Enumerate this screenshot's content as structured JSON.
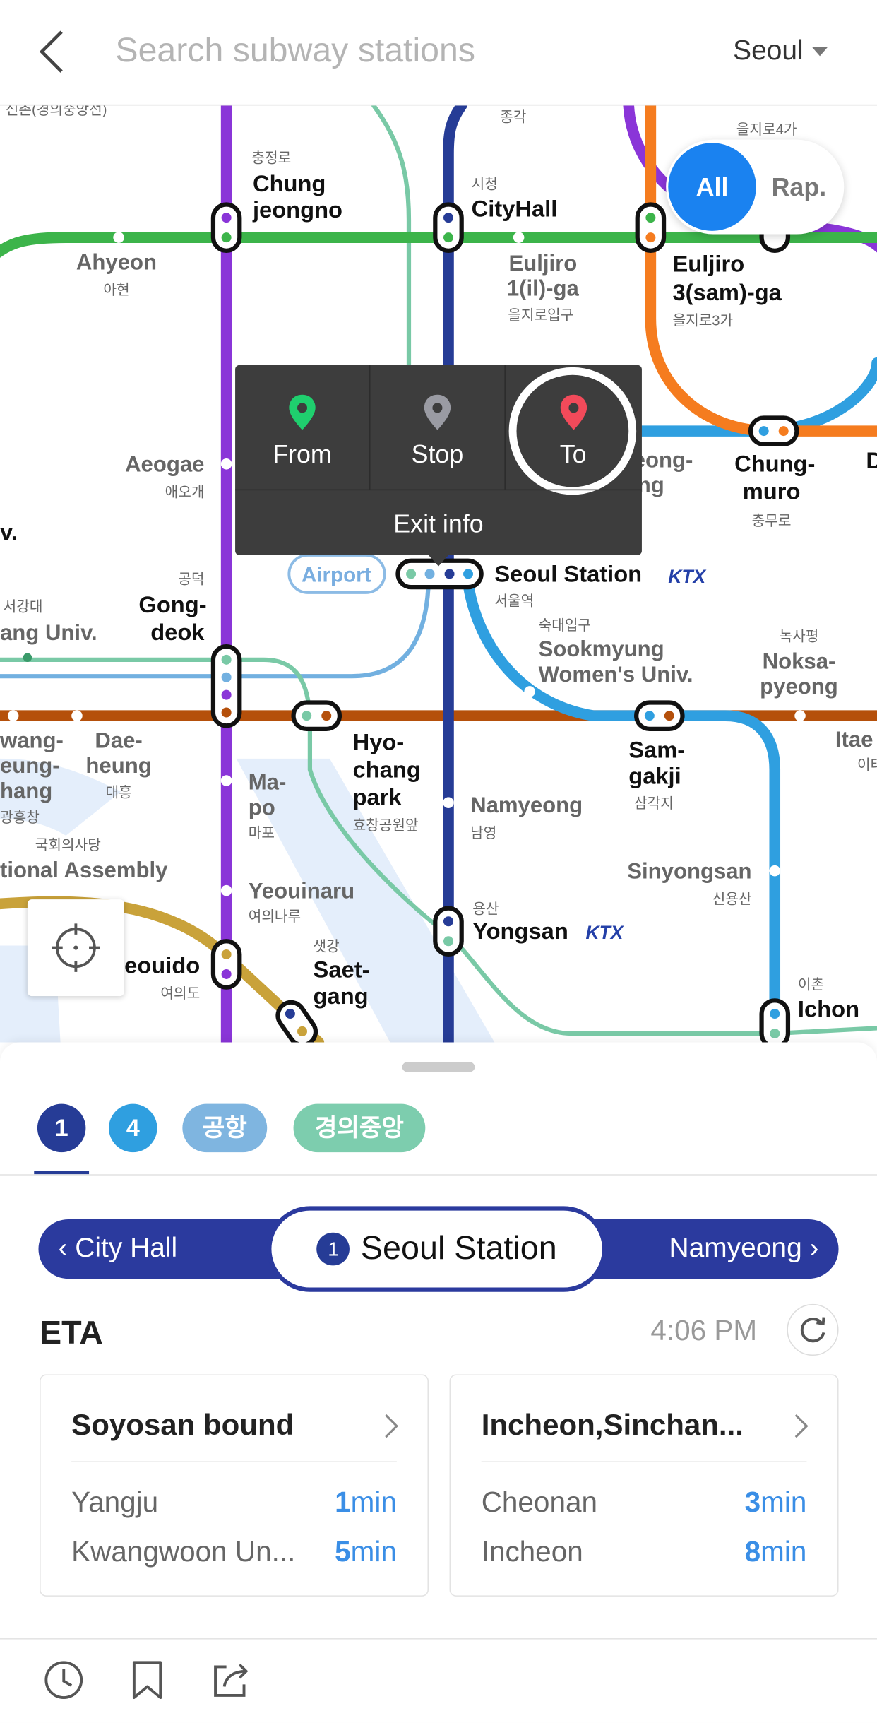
{
  "header": {
    "search_placeholder": "Search subway stations",
    "city": "Seoul"
  },
  "colors": {
    "line1": "#263c96",
    "line2": "#3cb44a",
    "line3": "#f57c1f",
    "line4": "#2f9fe0",
    "line5": "#8a35d8",
    "line6": "#b5500b",
    "line9": "#c9a23a",
    "gyeongui": "#79c9a6",
    "airport": "#72b0e0",
    "accent": "#1a82f0"
  },
  "map": {
    "toggle": {
      "all": "All",
      "rapid": "Rap."
    },
    "popup": {
      "from": "From",
      "stop": "Stop",
      "to": "To",
      "exit_info": "Exit info"
    },
    "airport_badge": "Airport",
    "ktx": "KTX",
    "stations": {
      "sinchon": {
        "ko": "신촌(경의중앙선)"
      },
      "jonggak": {
        "ko": "종각"
      },
      "euljiro4ga": {
        "ko": "을지로4가"
      },
      "chungjeongno": {
        "en1": "Chung",
        "en2": "jeongno",
        "ko": "충정로"
      },
      "cityhall": {
        "en": "CityHall",
        "ko": "시청"
      },
      "ahyeon": {
        "en": "Ahyeon",
        "ko": "아현"
      },
      "euljiro1ga": {
        "en1": "Euljiro",
        "en2": "1(il)-ga",
        "ko": "을지로입구"
      },
      "euljiro3ga": {
        "en1": "Euljiro",
        "en2": "3(sam)-ga",
        "ko": "을지로3가"
      },
      "aeogae": {
        "en": "Aeogae",
        "ko": "애오개"
      },
      "edge_v": {
        "en": "v."
      },
      "ddp": {
        "en1": "yeong-",
        "en2": "ng"
      },
      "edge_d": {
        "en": "D"
      },
      "chungmuro": {
        "en1": "Chung-",
        "en2": "muro",
        "ko": "충무로"
      },
      "seoul": {
        "en": "Seoul Station",
        "ko": "서울역"
      },
      "gongdeok": {
        "en1": "Gong-",
        "en2": "deok",
        "ko": "공덕"
      },
      "sogang": {
        "en": "ang Univ.",
        "ko": "서강대"
      },
      "sookmyung": {
        "en1": "Sookmyung",
        "en2": "Women's Univ.",
        "ko": "숙대입구"
      },
      "noksapyeong": {
        "en1": "Noksa-",
        "en2": "pyeong",
        "ko": "녹사평"
      },
      "itaewon": {
        "en": "Itae",
        "ko": "이태"
      },
      "gwangheungchang": {
        "en1": "wang-",
        "en2": "eung-",
        "en3": "hang",
        "ko": "광흥창"
      },
      "daeheung": {
        "en1": "Dae-",
        "en2": "heung",
        "ko": "대흥"
      },
      "hyochang": {
        "en1": "Hyo-",
        "en2": "chang",
        "en3": "park",
        "ko": "효창공원앞"
      },
      "samgakji": {
        "en1": "Sam-",
        "en2": "gakji",
        "ko": "삼각지"
      },
      "mapo": {
        "en1": "Ma-",
        "en2": "po",
        "ko": "마포"
      },
      "namyeong": {
        "en": "Namyeong",
        "ko": "남영"
      },
      "assembly": {
        "en": "tional Assembly",
        "ko": "국회의사당"
      },
      "yeouinaru": {
        "en": "Yeouinaru",
        "ko": "여의나루"
      },
      "sinyongsan": {
        "en": "Sinyongsan",
        "ko": "신용산"
      },
      "yongsan": {
        "en": "Yongsan",
        "ko": "용산"
      },
      "yeouido": {
        "en": "eouido",
        "ko": "여의도"
      },
      "saetgang": {
        "en1": "Saet-",
        "en2": "gang",
        "ko": "샛강"
      },
      "ichon": {
        "en": "Ichon",
        "ko": "이촌"
      }
    }
  },
  "sheet": {
    "line_tabs": [
      {
        "label": "1",
        "color": "#263c96",
        "selected": true
      },
      {
        "label": "4",
        "color": "#2f9fe0"
      },
      {
        "label": "공항",
        "color": "#7fb5e0"
      },
      {
        "label": "경의중앙",
        "color": "#7dcdae"
      }
    ],
    "prev_station": "City Hall",
    "current_station": "Seoul Station",
    "current_line": "1",
    "next_station": "Namyeong",
    "eta_label": "ETA",
    "time": "4:06 PM",
    "cards": [
      {
        "title": "Soyosan bound",
        "rows": [
          {
            "dest": "Yangju",
            "min": "1",
            "unit": "min"
          },
          {
            "dest": "Kwangwoon Un...",
            "min": "5",
            "unit": "min"
          }
        ]
      },
      {
        "title": "Incheon,Sinchan...",
        "rows": [
          {
            "dest": "Cheonan",
            "min": "3",
            "unit": "min"
          },
          {
            "dest": "Incheon",
            "min": "8",
            "unit": "min"
          }
        ]
      }
    ]
  }
}
